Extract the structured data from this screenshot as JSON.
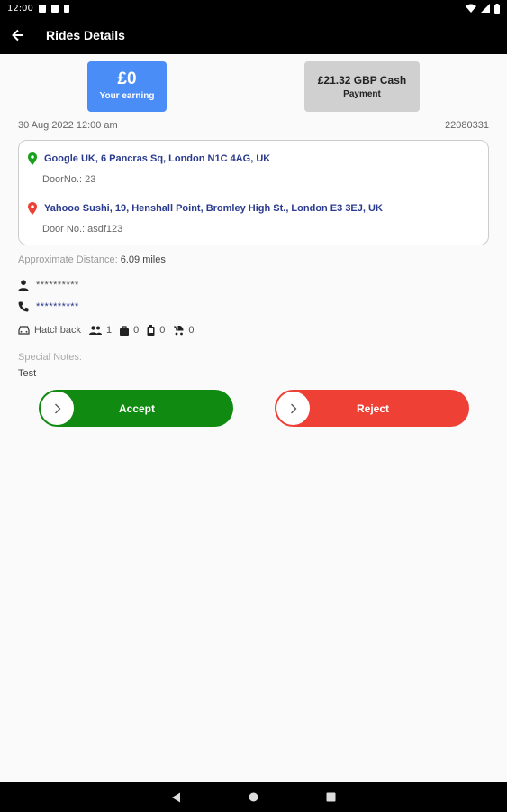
{
  "status_bar": {
    "time": "12:00"
  },
  "app_bar": {
    "title": "Rides Details"
  },
  "earning": {
    "amount": "£0",
    "label": "Your earning"
  },
  "payment": {
    "amount": "£21.32 GBP Cash",
    "label": "Payment"
  },
  "ride": {
    "datetime": "30 Aug 2022 12:00 am",
    "id": "22080331"
  },
  "pickup": {
    "address": "Google UK, 6 Pancras Sq, London N1C 4AG, UK",
    "door": "DoorNo.: 23"
  },
  "dropoff": {
    "address": "Yahooo Sushi, 19, Henshall Point, Bromley High St., London E3 3EJ, UK",
    "door": "Door No.: asdf123"
  },
  "distance": {
    "label": "Approximate Distance:",
    "value": "6.09 miles"
  },
  "passenger": {
    "name": "**********",
    "phone": "**********"
  },
  "vehicle": {
    "type": "Hatchback",
    "passengers": "1",
    "bags": "0",
    "luggage": "0",
    "child_seats": "0"
  },
  "notes": {
    "label": "Special Notes:",
    "value": "Test"
  },
  "actions": {
    "accept": "Accept",
    "reject": "Reject"
  },
  "colors": {
    "accept": "#108a10",
    "reject": "#ee4035",
    "earning": "#4a8df6",
    "address": "#2a3a8e"
  }
}
